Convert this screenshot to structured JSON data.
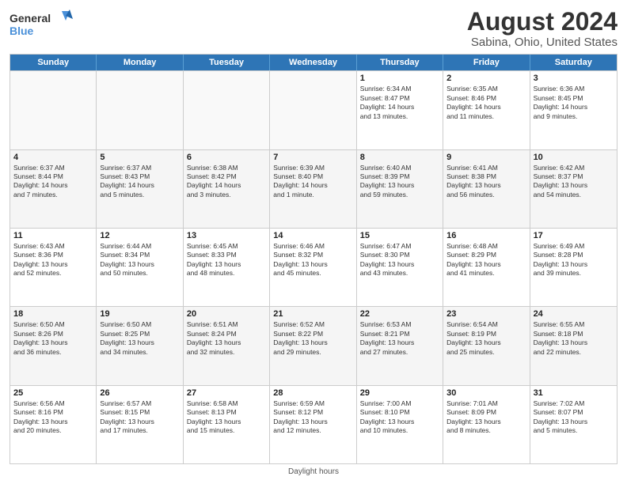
{
  "logo": {
    "line1": "General",
    "line2": "Blue"
  },
  "title": "August 2024",
  "subtitle": "Sabina, Ohio, United States",
  "header_days": [
    "Sunday",
    "Monday",
    "Tuesday",
    "Wednesday",
    "Thursday",
    "Friday",
    "Saturday"
  ],
  "footer": "Daylight hours",
  "weeks": [
    [
      {
        "day": "",
        "info": "",
        "empty": true
      },
      {
        "day": "",
        "info": "",
        "empty": true
      },
      {
        "day": "",
        "info": "",
        "empty": true
      },
      {
        "day": "",
        "info": "",
        "empty": true
      },
      {
        "day": "1",
        "info": "Sunrise: 6:34 AM\nSunset: 8:47 PM\nDaylight: 14 hours\nand 13 minutes.",
        "empty": false
      },
      {
        "day": "2",
        "info": "Sunrise: 6:35 AM\nSunset: 8:46 PM\nDaylight: 14 hours\nand 11 minutes.",
        "empty": false
      },
      {
        "day": "3",
        "info": "Sunrise: 6:36 AM\nSunset: 8:45 PM\nDaylight: 14 hours\nand 9 minutes.",
        "empty": false
      }
    ],
    [
      {
        "day": "4",
        "info": "Sunrise: 6:37 AM\nSunset: 8:44 PM\nDaylight: 14 hours\nand 7 minutes.",
        "empty": false
      },
      {
        "day": "5",
        "info": "Sunrise: 6:37 AM\nSunset: 8:43 PM\nDaylight: 14 hours\nand 5 minutes.",
        "empty": false
      },
      {
        "day": "6",
        "info": "Sunrise: 6:38 AM\nSunset: 8:42 PM\nDaylight: 14 hours\nand 3 minutes.",
        "empty": false
      },
      {
        "day": "7",
        "info": "Sunrise: 6:39 AM\nSunset: 8:40 PM\nDaylight: 14 hours\nand 1 minute.",
        "empty": false
      },
      {
        "day": "8",
        "info": "Sunrise: 6:40 AM\nSunset: 8:39 PM\nDaylight: 13 hours\nand 59 minutes.",
        "empty": false
      },
      {
        "day": "9",
        "info": "Sunrise: 6:41 AM\nSunset: 8:38 PM\nDaylight: 13 hours\nand 56 minutes.",
        "empty": false
      },
      {
        "day": "10",
        "info": "Sunrise: 6:42 AM\nSunset: 8:37 PM\nDaylight: 13 hours\nand 54 minutes.",
        "empty": false
      }
    ],
    [
      {
        "day": "11",
        "info": "Sunrise: 6:43 AM\nSunset: 8:36 PM\nDaylight: 13 hours\nand 52 minutes.",
        "empty": false
      },
      {
        "day": "12",
        "info": "Sunrise: 6:44 AM\nSunset: 8:34 PM\nDaylight: 13 hours\nand 50 minutes.",
        "empty": false
      },
      {
        "day": "13",
        "info": "Sunrise: 6:45 AM\nSunset: 8:33 PM\nDaylight: 13 hours\nand 48 minutes.",
        "empty": false
      },
      {
        "day": "14",
        "info": "Sunrise: 6:46 AM\nSunset: 8:32 PM\nDaylight: 13 hours\nand 45 minutes.",
        "empty": false
      },
      {
        "day": "15",
        "info": "Sunrise: 6:47 AM\nSunset: 8:30 PM\nDaylight: 13 hours\nand 43 minutes.",
        "empty": false
      },
      {
        "day": "16",
        "info": "Sunrise: 6:48 AM\nSunset: 8:29 PM\nDaylight: 13 hours\nand 41 minutes.",
        "empty": false
      },
      {
        "day": "17",
        "info": "Sunrise: 6:49 AM\nSunset: 8:28 PM\nDaylight: 13 hours\nand 39 minutes.",
        "empty": false
      }
    ],
    [
      {
        "day": "18",
        "info": "Sunrise: 6:50 AM\nSunset: 8:26 PM\nDaylight: 13 hours\nand 36 minutes.",
        "empty": false
      },
      {
        "day": "19",
        "info": "Sunrise: 6:50 AM\nSunset: 8:25 PM\nDaylight: 13 hours\nand 34 minutes.",
        "empty": false
      },
      {
        "day": "20",
        "info": "Sunrise: 6:51 AM\nSunset: 8:24 PM\nDaylight: 13 hours\nand 32 minutes.",
        "empty": false
      },
      {
        "day": "21",
        "info": "Sunrise: 6:52 AM\nSunset: 8:22 PM\nDaylight: 13 hours\nand 29 minutes.",
        "empty": false
      },
      {
        "day": "22",
        "info": "Sunrise: 6:53 AM\nSunset: 8:21 PM\nDaylight: 13 hours\nand 27 minutes.",
        "empty": false
      },
      {
        "day": "23",
        "info": "Sunrise: 6:54 AM\nSunset: 8:19 PM\nDaylight: 13 hours\nand 25 minutes.",
        "empty": false
      },
      {
        "day": "24",
        "info": "Sunrise: 6:55 AM\nSunset: 8:18 PM\nDaylight: 13 hours\nand 22 minutes.",
        "empty": false
      }
    ],
    [
      {
        "day": "25",
        "info": "Sunrise: 6:56 AM\nSunset: 8:16 PM\nDaylight: 13 hours\nand 20 minutes.",
        "empty": false
      },
      {
        "day": "26",
        "info": "Sunrise: 6:57 AM\nSunset: 8:15 PM\nDaylight: 13 hours\nand 17 minutes.",
        "empty": false
      },
      {
        "day": "27",
        "info": "Sunrise: 6:58 AM\nSunset: 8:13 PM\nDaylight: 13 hours\nand 15 minutes.",
        "empty": false
      },
      {
        "day": "28",
        "info": "Sunrise: 6:59 AM\nSunset: 8:12 PM\nDaylight: 13 hours\nand 12 minutes.",
        "empty": false
      },
      {
        "day": "29",
        "info": "Sunrise: 7:00 AM\nSunset: 8:10 PM\nDaylight: 13 hours\nand 10 minutes.",
        "empty": false
      },
      {
        "day": "30",
        "info": "Sunrise: 7:01 AM\nSunset: 8:09 PM\nDaylight: 13 hours\nand 8 minutes.",
        "empty": false
      },
      {
        "day": "31",
        "info": "Sunrise: 7:02 AM\nSunset: 8:07 PM\nDaylight: 13 hours\nand 5 minutes.",
        "empty": false
      }
    ]
  ]
}
